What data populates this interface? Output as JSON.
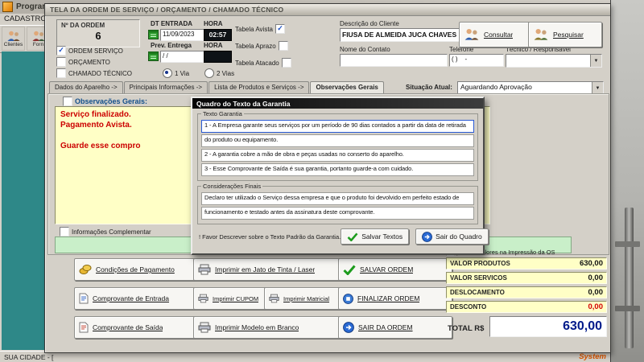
{
  "icons": {
    "dropdown_arrow": "▼",
    "check_small": "✓"
  },
  "taskbar_app": {
    "title": "Programa O",
    "menu_cadastros": "CADASTROS",
    "toolbar": {
      "clientes": "Clientes",
      "fornecedores": "Forn"
    },
    "statusbar_text": "SUA CIDADE - [",
    "brand": "System"
  },
  "order_window": {
    "title": "TELA DA ORDEM DE SERVIÇO / ORÇAMENTO / CHAMADO TÉCNICO",
    "header": {
      "num_ordem_label": "Nº DA ORDEM",
      "num_ordem_value": "6",
      "dt_entrada_label": "DT ENTRADA",
      "hora_label": "HORA",
      "dt_entrada_value": "11/09/2023",
      "hora_value": "02:57",
      "prev_entrega_label": "Prev. Entrega",
      "prev_hora_label": "HORA",
      "prev_entrega_value": "/ /",
      "chk_ordem_servico": "ORDEM SERVIÇO",
      "chk_orcamento": "ORÇAMENTO",
      "chk_chamado": "CHAMADO TÉCNICO",
      "radio_1via": "1 Via",
      "radio_2vias": "2 Vias",
      "chk_tabela_avista": "Tabela Avista",
      "chk_tabela_aprazo": "Tabela Aprazo",
      "chk_tabela_atacado": "Tabela Atacado",
      "descricao_cliente_label": "Descrição do Cliente",
      "descricao_cliente_value": "FIUSA DE ALMEIDA JUCA CHAVES",
      "nome_contato_label": "Nome do Contato",
      "nome_contato_value": "",
      "telefone_label": "Telefone",
      "telefone_value": "( )    -",
      "tecnico_label": "Técnico / Responsável",
      "tecnico_value": "",
      "btn_consultar": "Consultar",
      "btn_pesquisar": "Pesquisar"
    },
    "tabs": [
      {
        "label": "Dados do Aparelho ->"
      },
      {
        "label": "Principais Informações ->"
      },
      {
        "label": "Lista de Produtos e Serviços ->"
      },
      {
        "label": "Observações Gerais"
      }
    ],
    "situacao": {
      "label": "Situação Atual:",
      "value": "Aguardando Aprovação"
    },
    "obs_tab": {
      "obs_label": "Observações Gerais:",
      "obs_lines": [
        "Serviço finalizado.",
        "Pagamento Avista.",
        "",
        "Guarde esse compro"
      ],
      "info_complementar_label": "Informações Complementar"
    },
    "actions": {
      "condicoes_pagamento": "Condições de Pagamento",
      "comprovante_entrada": "Comprovante de Entrada",
      "comprovante_saida": "Comprovante de Saída",
      "imprimir_jato": "Imprimir em Jato de Tinta / Laser",
      "imprimir_cupom": "Imprimir CUPOM",
      "imprimir_matricial": "Imprimir Matricial",
      "imprimir_branco": "Imprimir Modelo em Branco",
      "salvar_ordem": "SALVAR ORDEM",
      "finalizar_ordem": "FINALIZAR ORDEM",
      "sair_ordem": "SAIR DA ORDEM"
    },
    "totals": {
      "aparecer_label": "parecer valores na Impressão da OS",
      "rows": [
        {
          "label": "VALOR PRODUTOS",
          "value": "630,00"
        },
        {
          "label": "VALOR SERVICOS",
          "value": "0,00"
        },
        {
          "label": "DESLOCAMENTO",
          "value": "0,00"
        },
        {
          "label": "DESCONTO",
          "value": "0,00"
        }
      ],
      "total_label": "TOTAL R$",
      "total_value": "630,00"
    }
  },
  "garantia_modal": {
    "title": "Quadro do Texto da Garantia",
    "texto_garantia_label": "Texto Garantia",
    "texto_lines": [
      "1 - A Empresa garante seus serviços por um período de 90 dias contados a partir da data de retirada",
      "do produto ou equipamento.",
      "2 - A garantia cobre a mão de obra e peças usadas no conserto do aparelho.",
      "3 - Esse Comprovante de Saída é sua garantia, portanto guarde-a com cuidado."
    ],
    "consideracoes_label": "Considerações Finais",
    "consideracoes_lines": [
      "Declaro ter utilizado o Serviço dessa empresa e que o produto foi devolvido em perfeito estado de",
      "funcionamento e testado antes da assinatura deste comprovante."
    ],
    "hint": "! Favor Descrever sobre o Texto Padrão da Garantia.",
    "btn_salvar": "Salvar Textos",
    "btn_sair": "Sair do Quadro"
  }
}
